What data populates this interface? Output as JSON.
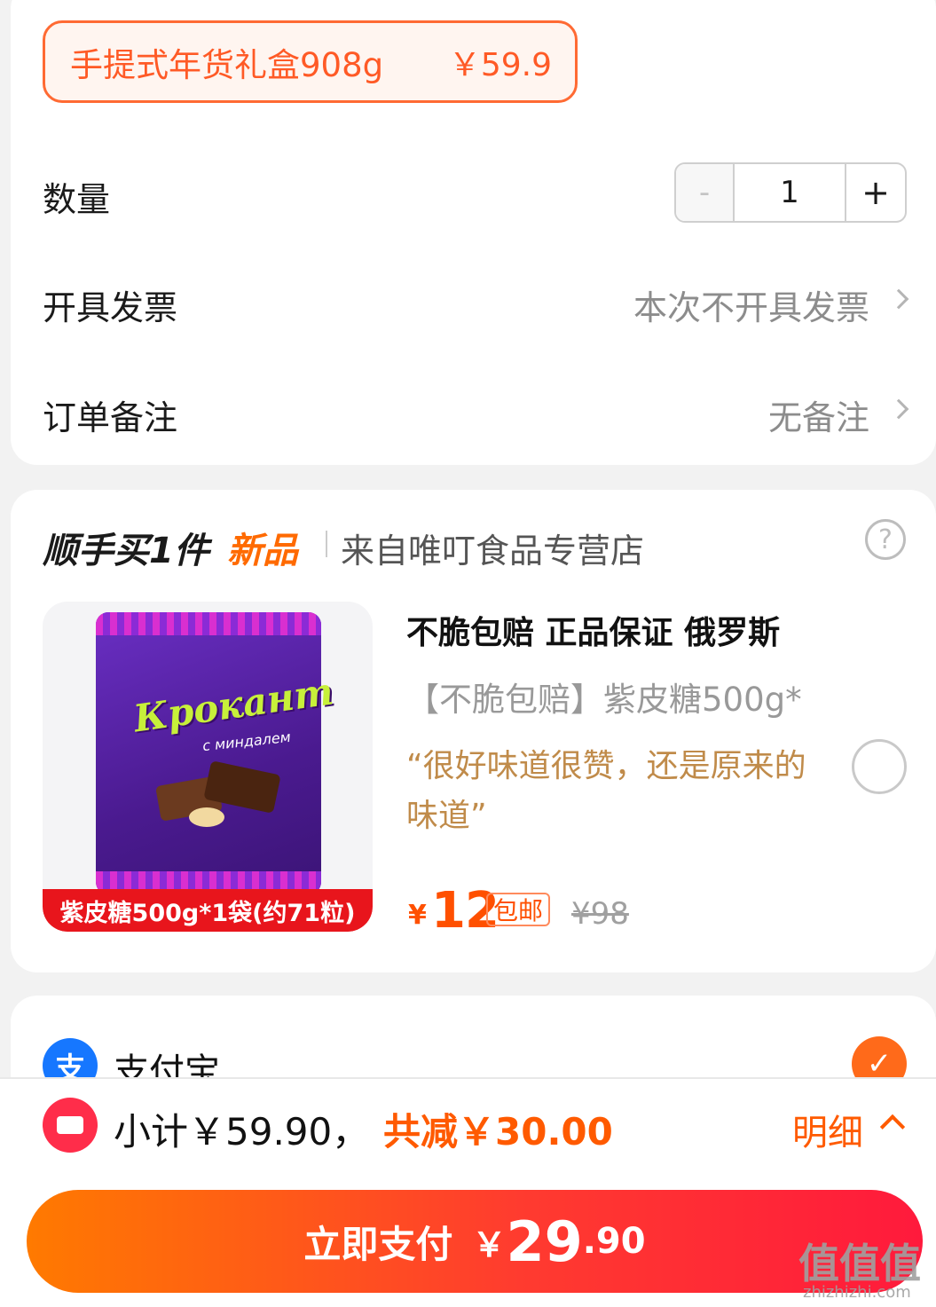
{
  "spec": {
    "name": "手提式年货礼盒908g",
    "price": "￥59.9"
  },
  "quantity": {
    "label": "数量",
    "minus": "-",
    "value": "1",
    "plus": "+"
  },
  "invoice": {
    "label": "开具发票",
    "value": "本次不开具发票"
  },
  "remark": {
    "label": "订单备注",
    "value": "无备注"
  },
  "addon": {
    "title": "顺手买1件",
    "tag": "新品",
    "store": "来自唯叮食品专营店",
    "help": "?",
    "image_label": "紫皮糖500g*1袋(约71粒)",
    "brand": "Крокант",
    "brand_sub": "с миндалем",
    "product_title": "不脆包赔 正品保证 俄罗斯",
    "product_subtitle": "【不脆包赔】紫皮糖500g*",
    "review": "“很好味道很赞，还是原来的味道”",
    "currency": "¥",
    "price": "12",
    "shipping": "包邮",
    "original_price": "¥98"
  },
  "payment": {
    "method": "支付宝",
    "icon_glyph": "支",
    "check_glyph": "✓"
  },
  "summary": {
    "subtotal": "小计￥59.90，",
    "discount": "共减￥30.00",
    "detail": "明细"
  },
  "pay_button": {
    "label": "立即支付",
    "currency": "￥",
    "amount_int": "29",
    "amount_dec": ".90"
  },
  "watermark": {
    "text": "值值值",
    "url": "zhizhizhi.com"
  },
  "colors": {
    "accent": "#ff5a00",
    "alipay": "#1677ff",
    "coupon": "#ff2d4a"
  }
}
